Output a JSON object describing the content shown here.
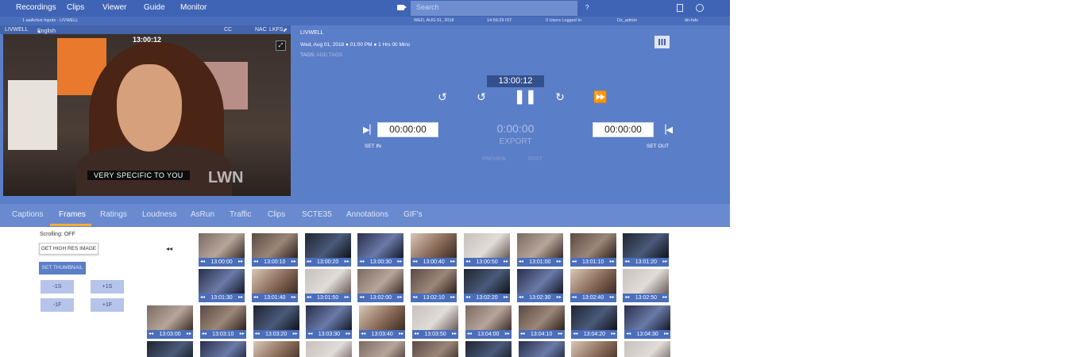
{
  "nav": {
    "items": [
      "Recordings",
      "Clips",
      "Viewer",
      "Guide",
      "Monitor"
    ],
    "search_placeholder": "Search",
    "help": "?"
  },
  "status": {
    "left": "1 aaActive Inputs - LIVWELL",
    "date": "WED, AUG 01, 2018",
    "time": "14:59:29 IST",
    "users": "0 Users Logged In",
    "user": "Dz_admin",
    "host": "dn-hds"
  },
  "player": {
    "channel": "LIVWELL",
    "language": "English",
    "cc": "CC",
    "nac": "NAC",
    "lkfs": "LKFS",
    "overlay_timecode": "13:00:12",
    "subtitle": "VERY SPECIFIC TO YOU",
    "watermark": "LWN"
  },
  "info": {
    "channel": "LIVWELL",
    "date": "Wed, Aug 01, 2018",
    "start": "01:00 PM",
    "duration": "1 Hrs 00 Mins",
    "tags_label": "TAGS:",
    "add_tags": "ADD TAGS"
  },
  "transport": {
    "timecode": "13:00:12",
    "set_in_time": "00:00:00",
    "set_out_time": "00:00:00",
    "duration_time": "0:00:00",
    "export": "EXPORT",
    "preview": "PREVIEW",
    "post": "POST",
    "set_in": "SET IN",
    "set_out": "SET OUT"
  },
  "tabs": [
    "Captions",
    "Frames",
    "Ratings",
    "Loudness",
    "AsRun",
    "Traffic",
    "Clips",
    "SCTE35",
    "Annotations",
    "GIF's"
  ],
  "active_tab": "Frames",
  "frames_panel": {
    "scrolling": "Scrolling: OFF",
    "get_high_res": "GET HIGH RES IMAGE",
    "set_thumbnail": "SET THUMBNAIL",
    "minus_1s": "-1S",
    "plus_1s": "+1S",
    "minus_1f": "-1F",
    "plus_1f": "+1F"
  },
  "frames": [
    [
      "13:00:00",
      "13:00:10",
      "13:00:20",
      "13:00:30",
      "13:00:40",
      "13:00:50",
      "13:01:00",
      "13:01:10",
      "13:01:20"
    ],
    [
      "13:01:30",
      "13:01:40",
      "13:01:50",
      "13:02:00",
      "13:02:10",
      "13:02:20",
      "13:02:30",
      "13:02:40",
      "13:02:50"
    ],
    [
      "13:03:00",
      "13:03:10",
      "13:03:20",
      "13:03:30",
      "13:03:40",
      "13:03:50",
      "13:04:00",
      "13:04:10",
      "13:04:20",
      "13:04:30"
    ]
  ],
  "colors": {
    "nav_bg": "#3f64b5",
    "panel_bg": "#5b7ec8",
    "tabs_bg": "#6a8ad0",
    "active_underline": "#f0b036"
  }
}
